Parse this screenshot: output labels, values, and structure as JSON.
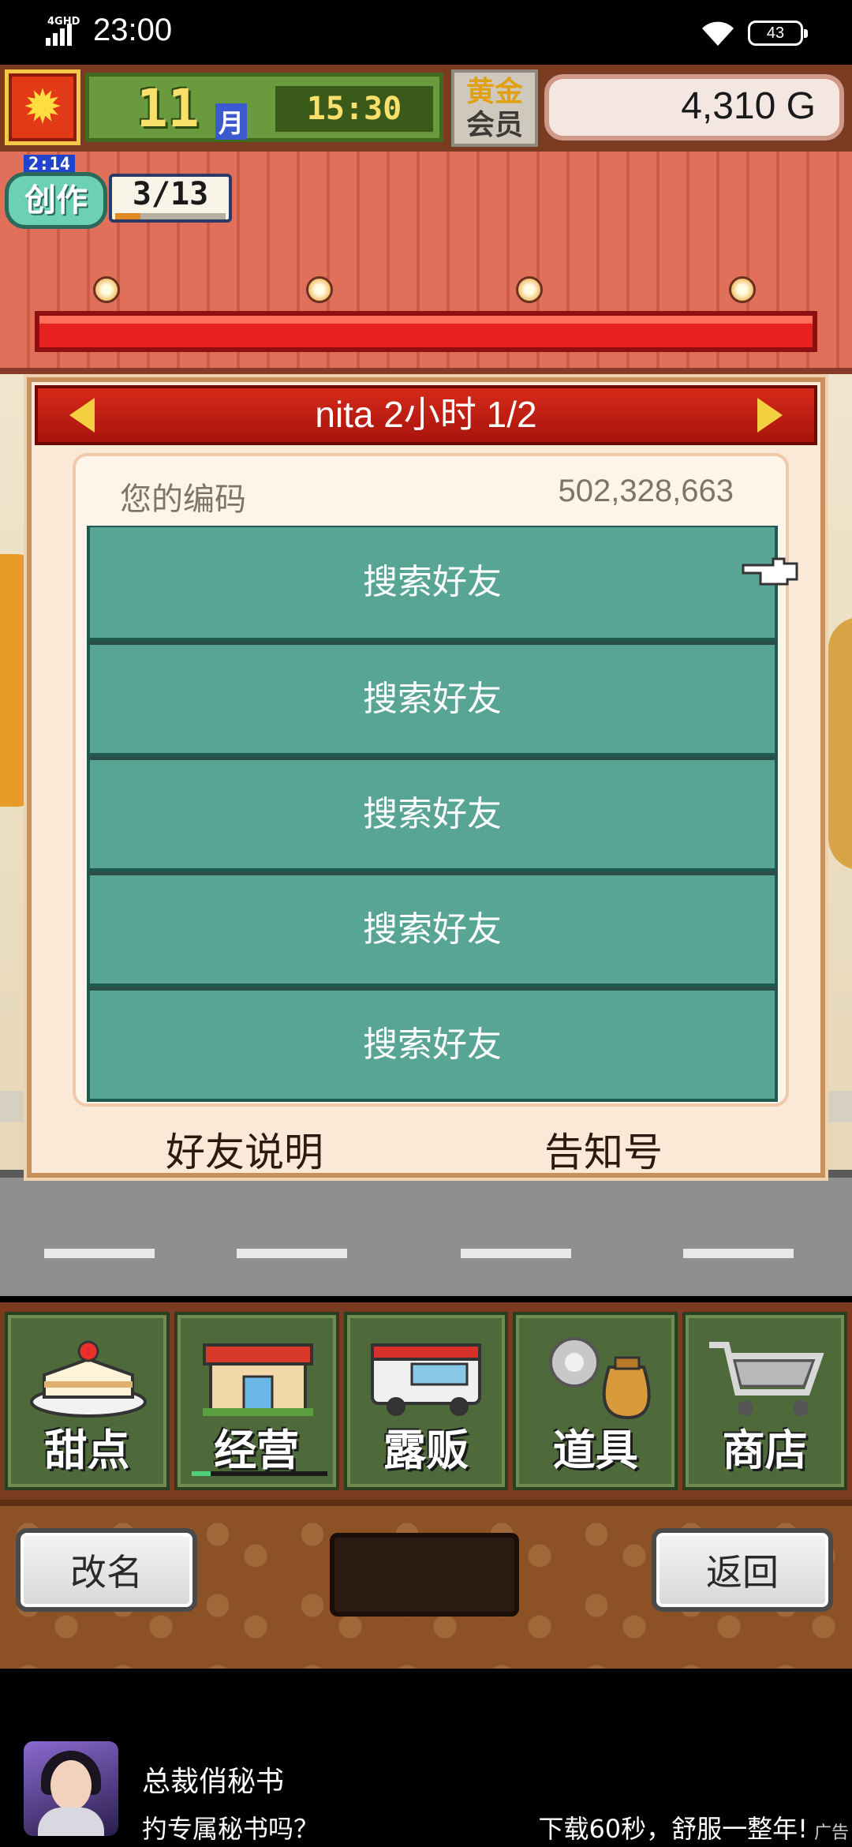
{
  "status_bar": {
    "network": "4GHD",
    "time": "23:00",
    "battery": "43"
  },
  "hud": {
    "month_number": "11",
    "month_unit": "月",
    "clock": "15:30",
    "gold_member_line1": "黄金",
    "gold_member_line2": "会员",
    "money": "4,310 G",
    "create_timer": "2:14",
    "create_label": "创作",
    "create_count": "3/13",
    "create_progress": 0.23
  },
  "dialog": {
    "title": "nita  2小时 1/2",
    "code_label": "您的编码",
    "code_value": "502,328,663",
    "friend_slots": [
      "搜索好友",
      "搜索好友",
      "搜索好友",
      "搜索好友",
      "搜索好友"
    ],
    "footer_left": "好友说明",
    "footer_right": "告知号"
  },
  "menu": [
    {
      "label": "甜点",
      "icon": "cake-icon"
    },
    {
      "label": "经营",
      "icon": "shop-icon"
    },
    {
      "label": "露贩",
      "icon": "food-truck-icon"
    },
    {
      "label": "道具",
      "icon": "items-bag-icon"
    },
    {
      "label": "商店",
      "icon": "shopping-cart-icon"
    }
  ],
  "menu_manage_progress": 0.14,
  "toolbar": {
    "rename": "改名",
    "back": "返回"
  },
  "ad": {
    "title": "总裁俏秘书",
    "text_left": "扚专属秘书吗？",
    "text_right": "下载60秒，舒服一整年!",
    "tag": "广告"
  },
  "colors": {
    "dialog_header": "#c41e12",
    "friend_button": "#58a596",
    "menu_tile": "#4e6a3a",
    "hud_bar": "#7a3b20"
  }
}
